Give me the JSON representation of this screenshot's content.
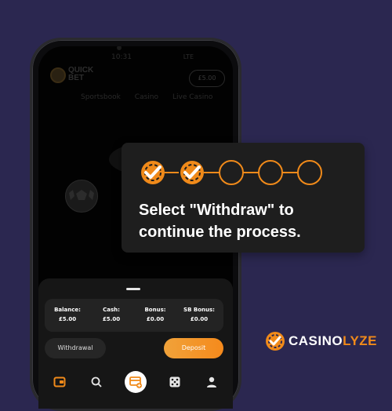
{
  "status": {
    "time": "10:31",
    "right": "LTE"
  },
  "app": {
    "logo_line1": "QUICK",
    "logo_line2": "BET",
    "balance": "£5.00"
  },
  "nav_tabs": [
    "Sportsbook",
    "Casino",
    "Live Casino"
  ],
  "balances": [
    {
      "label": "Balance:",
      "value": "£5.00"
    },
    {
      "label": "Cash:",
      "value": "£5.00"
    },
    {
      "label": "Bonus:",
      "value": "£0.00"
    },
    {
      "label": "SB Bonus:",
      "value": "£0.00"
    }
  ],
  "actions": {
    "withdrawal": "Withdrawal",
    "deposit": "Deposit"
  },
  "bottom_nav_icons": [
    "wallet-icon",
    "search-icon",
    "cashier-icon",
    "dice-icon",
    "user-icon"
  ],
  "popup": {
    "text": "Select \"Withdraw\" to continue the process.",
    "steps_done": 2,
    "steps_total": 5
  },
  "brand": {
    "part1": "CASINO",
    "part2": "LYZE"
  },
  "colors": {
    "accent": "#f08a1a",
    "background": "#2b2750",
    "popup": "#1e1e1e"
  }
}
